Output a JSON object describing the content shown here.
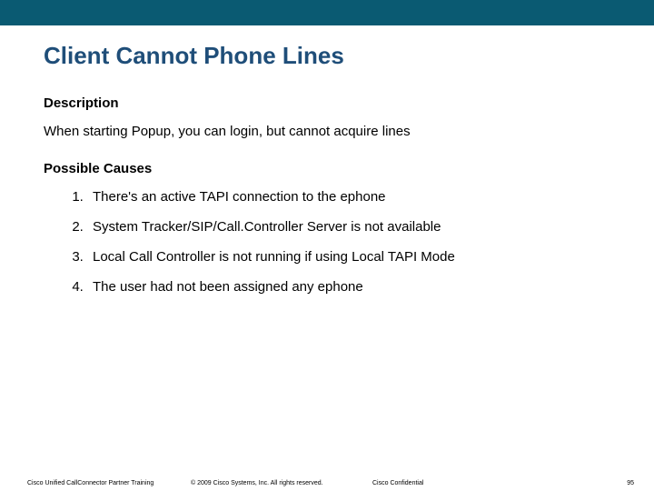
{
  "title": "Client Cannot Phone Lines",
  "sections": {
    "description_heading": "Description",
    "description_text": "When starting Popup, you can login, but cannot acquire lines",
    "causes_heading": "Possible Causes",
    "causes": [
      "There's an active TAPI connection to the ephone",
      "System Tracker/SIP/Call.Controller Server is not available",
      "Local Call Controller is not running if using Local TAPI Mode",
      "The user had not been assigned any ephone"
    ]
  },
  "footer": {
    "left": "Cisco Unified CallConnector Partner Training",
    "mid": "© 2009 Cisco Systems, Inc. All rights reserved.",
    "mid2": "Cisco Confidential",
    "page": "95"
  }
}
